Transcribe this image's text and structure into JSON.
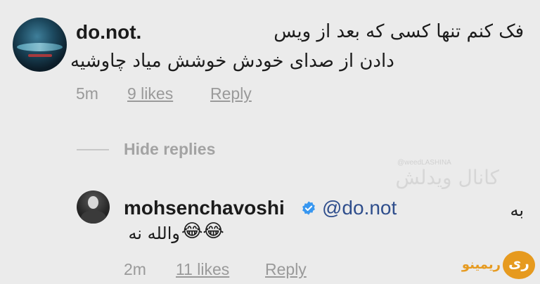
{
  "comment": {
    "username": "do.not.",
    "text_line1": "فک کنم تنها کسی که بعد از ویس",
    "text_line2": "دادن از صدای خودش خوشش میاد چاوشیه",
    "time": "5m",
    "likes": "9 likes",
    "reply_label": "Reply"
  },
  "hide_replies_label": "Hide replies",
  "reply": {
    "username": "mohsenchavoshi",
    "mention": "@do.not",
    "text_prefix": "به",
    "text": "والله نه",
    "emojis": "😂😂",
    "time": "2m",
    "likes": "11 likes",
    "reply_label": "Reply"
  },
  "watermark": {
    "text": "کانال ویدلش",
    "handle": "@weedLASHINA"
  },
  "logo": {
    "text": "ریمینو",
    "mark": "ری"
  },
  "colors": {
    "background": "#ebebeb",
    "mention": "#2f4e8c",
    "verified": "#3897f0",
    "meta": "#9a9a9a",
    "logo": "#e69a1f"
  }
}
